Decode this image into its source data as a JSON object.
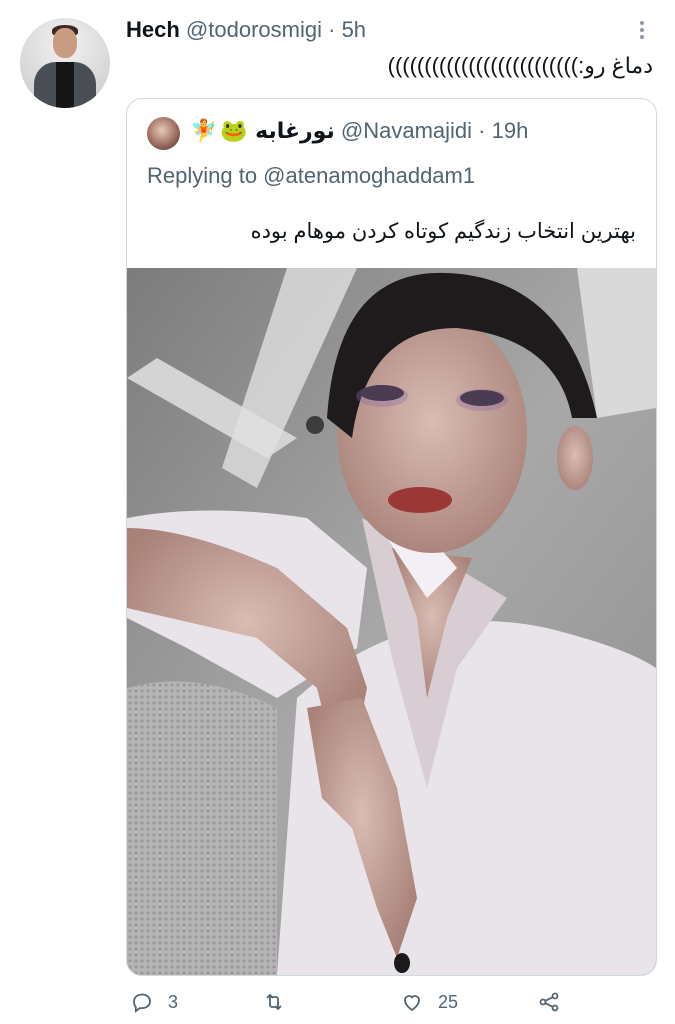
{
  "tweet": {
    "author_name": "Hech",
    "author_handle": "@todorosmigi",
    "separator": "·",
    "time": "5h",
    "text": "دماغ رو:))))))))))))))))))))))))))"
  },
  "quoted_tweet": {
    "emojis": [
      "🧚",
      "🐸"
    ],
    "author_name": "نورغابه",
    "author_handle": "@Navamajidi",
    "separator": "·",
    "time": "19h",
    "replying_to": "Replying to @atenamoghaddam1",
    "text": "بهترین انتخاب زندگیم کوتاه کردن موهام بوده"
  },
  "actions": {
    "reply_count": "3",
    "like_count": "25"
  },
  "icons": [
    "more-icon",
    "reply-icon",
    "retweet-icon",
    "like-icon",
    "share-icon"
  ],
  "colors": {
    "text_primary": "#0f1419",
    "text_secondary": "#536471",
    "border": "#cfd9de"
  }
}
